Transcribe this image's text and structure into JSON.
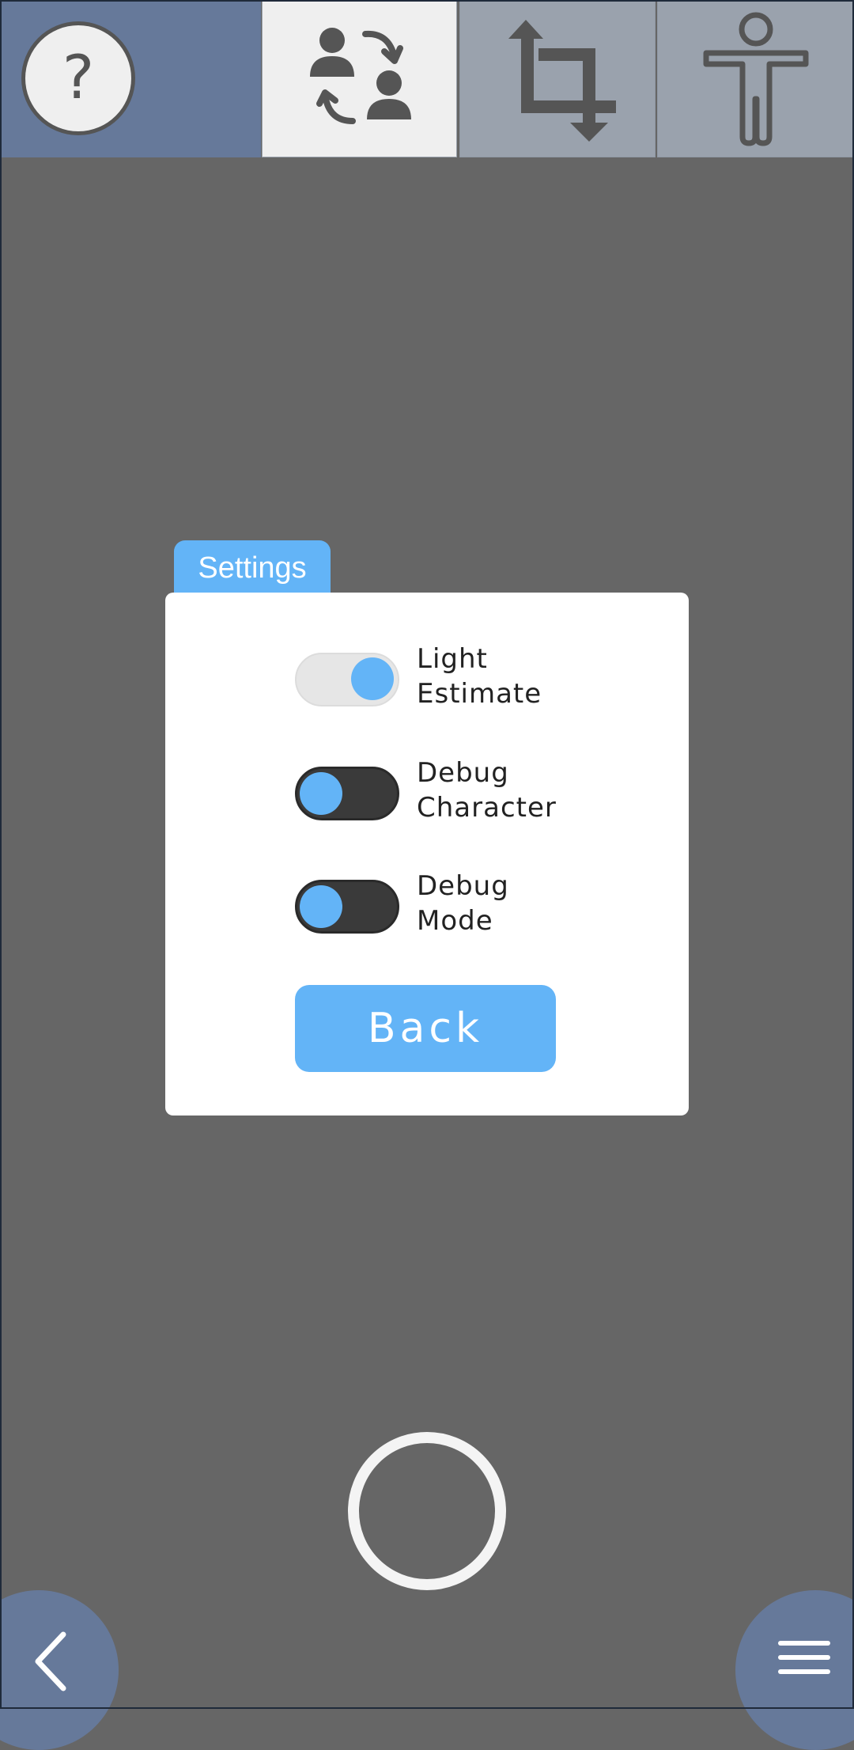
{
  "toolbar": {
    "items": [
      "help-icon",
      "swap-users-icon",
      "crop-icon",
      "body-pose-icon"
    ],
    "help_color": "#66799a",
    "active_tab_color": "#efefef",
    "inactive_tab_color": "#9aa2ad"
  },
  "settings": {
    "tab_label": "Settings",
    "toggles": [
      {
        "label_line1": "Light",
        "label_line2": "Estimate",
        "state": "on"
      },
      {
        "label_line1": "Debug",
        "label_line2": "Character",
        "state": "off"
      },
      {
        "label_line1": "Debug",
        "label_line2": "Mode",
        "state": "off"
      }
    ],
    "back_label": "Back",
    "accent_color": "#63b4f7"
  },
  "bottom": {
    "capture_icon": "capture-circle-icon",
    "back_icon": "chevron-left-icon",
    "menu_icon": "hamburger-menu-icon"
  }
}
